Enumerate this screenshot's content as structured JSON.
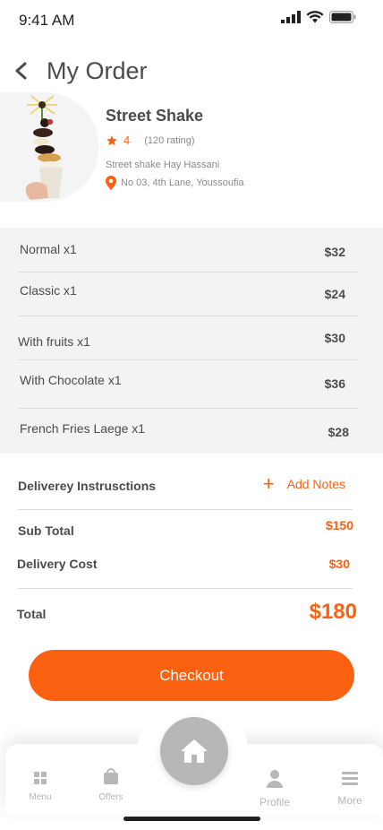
{
  "status_bar": {
    "time": "9:41 AM"
  },
  "header": {
    "title": "My Order"
  },
  "restaurant": {
    "name": "Street Shake",
    "rating": "4",
    "rating_count": "(120 rating)",
    "type": "Street shake Hay Hassani",
    "address": "No 03, 4th Lane, Youssoufia"
  },
  "items": [
    {
      "name": "Normal x1",
      "price": "$32"
    },
    {
      "name": "Classic  x1",
      "price": "$24"
    },
    {
      "name": "With fruits x1",
      "price": "$30"
    },
    {
      "name": "With Chocolate x1",
      "price": "$36"
    },
    {
      "name": "French Fries Laege x1",
      "price": "$28"
    }
  ],
  "instructions": {
    "label": "Deliverey Instrusctions",
    "add_label": "Add Notes",
    "add_symbol": "+"
  },
  "summary": {
    "subtotal_label": "Sub Total",
    "subtotal_value": "$150",
    "delivery_label": "Delivery Cost",
    "delivery_value": "$30",
    "total_label": "Total",
    "total_value": "$180"
  },
  "checkout_label": "Checkout",
  "tabbar": {
    "menu": "Menu",
    "offers": "Offers",
    "profile": "Profile",
    "more": "More"
  },
  "colors": {
    "accent": "#fc6011",
    "text": "#4a4b4d",
    "muted": "#b6b7b7",
    "panel": "#f3f3f3"
  },
  "icons": [
    "back-icon",
    "star-icon",
    "location-pin-icon",
    "plus-icon",
    "menu-grid-icon",
    "offers-bag-icon",
    "home-icon",
    "profile-icon",
    "more-list-icon"
  ]
}
